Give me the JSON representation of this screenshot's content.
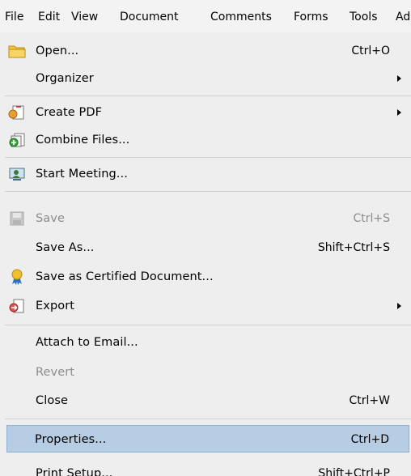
{
  "menubar": {
    "items": [
      "File",
      "Edit",
      "View",
      "Document",
      "Comments",
      "Forms",
      "Tools",
      "Ad"
    ]
  },
  "file_menu": {
    "open": {
      "label": "Open...",
      "shortcut": "Ctrl+O",
      "icon": "folder-icon"
    },
    "organizer": {
      "label": "Organizer"
    },
    "create_pdf": {
      "label": "Create PDF",
      "icon": "create-pdf-icon"
    },
    "combine_files": {
      "label": "Combine Files...",
      "icon": "combine-files-icon"
    },
    "start_meeting": {
      "label": "Start Meeting...",
      "icon": "meeting-icon"
    },
    "save": {
      "label": "Save",
      "shortcut": "Ctrl+S",
      "icon": "save-disk-icon",
      "disabled": true
    },
    "save_as": {
      "label": "Save As...",
      "shortcut": "Shift+Ctrl+S"
    },
    "save_certified": {
      "label": "Save as Certified Document...",
      "icon": "certified-ribbon-icon"
    },
    "export": {
      "label": "Export",
      "icon": "export-icon"
    },
    "attach_email": {
      "label": "Attach to Email..."
    },
    "revert": {
      "label": "Revert",
      "disabled": true
    },
    "close": {
      "label": "Close",
      "shortcut": "Ctrl+W"
    },
    "properties": {
      "label": "Properties...",
      "shortcut": "Ctrl+D",
      "highlighted": true
    },
    "print_setup": {
      "label": "Print Setup...",
      "shortcut": "Shift+Ctrl+P"
    }
  },
  "colors": {
    "menu_bg": "#eeeeee",
    "menubar_bg": "#f3f3f3",
    "highlight_bg": "#b7cde3",
    "disabled_text": "#8c8c8c",
    "separator": "#cfcfcf"
  }
}
